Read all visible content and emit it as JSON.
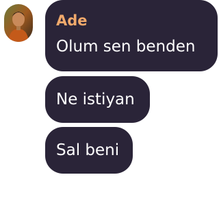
{
  "conversation": {
    "sender": {
      "name": "Ade",
      "name_color": "#f0a96b",
      "avatar": "avatar-photo"
    },
    "bubble_color": "#2a2438",
    "messages": [
      {
        "text": "Olum sen benden"
      },
      {
        "text": "Ne istiyan"
      },
      {
        "text": "Sal beni"
      }
    ]
  }
}
